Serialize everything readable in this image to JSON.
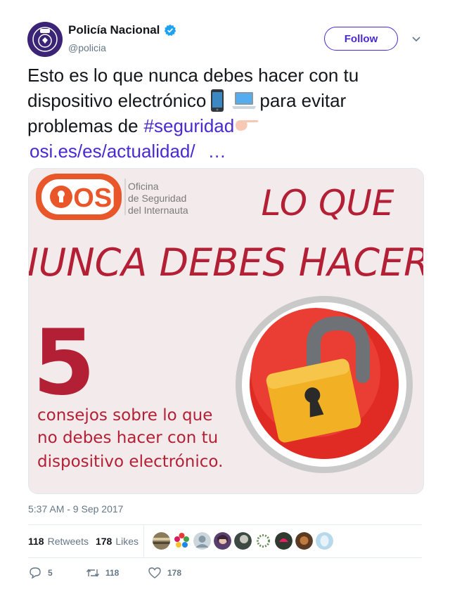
{
  "tweet": {
    "author_name": "Policía Nacional",
    "handle": "@policia",
    "follow_label": "Follow",
    "text_line1": "Esto es lo que nunca debes hacer con tu",
    "text_line2a": "dispositivo electrónico",
    "text_line2b": "para evitar",
    "text_line3a": "problemas de",
    "hashtag": "#seguridad",
    "link": "osi.es/es/actualidad/",
    "link_ellipsis": "…",
    "timestamp": "5:37 AM - 9 Sep 2017"
  },
  "media": {
    "logo_text": "OSI",
    "org_line1": "Oficina",
    "org_line2": "de Seguridad",
    "org_line3": "del Internauta",
    "headline1": "LO QUE",
    "headline2": "NUNCA DEBES HACER",
    "big_number": "5",
    "sub1": "consejos sobre lo que",
    "sub2": "no debes hacer con tu",
    "sub3": "dispositivo electrónico."
  },
  "stats": {
    "retweets_count": "118",
    "retweets_label": "Retweets",
    "likes_count": "178",
    "likes_label": "Likes"
  },
  "actions": {
    "reply_count": "5",
    "retweet_count": "118",
    "like_count": "178"
  },
  "colors": {
    "accent": "#4a2ad0",
    "brand_red": "#b32035",
    "osi_orange": "#e8562a"
  },
  "icons": [
    "verified-icon",
    "chevron-down-icon",
    "phone-emoji-icon",
    "laptop-emoji-icon",
    "pointing-hand-emoji-icon",
    "reply-icon",
    "retweet-icon",
    "like-icon",
    "padlock-icon"
  ]
}
